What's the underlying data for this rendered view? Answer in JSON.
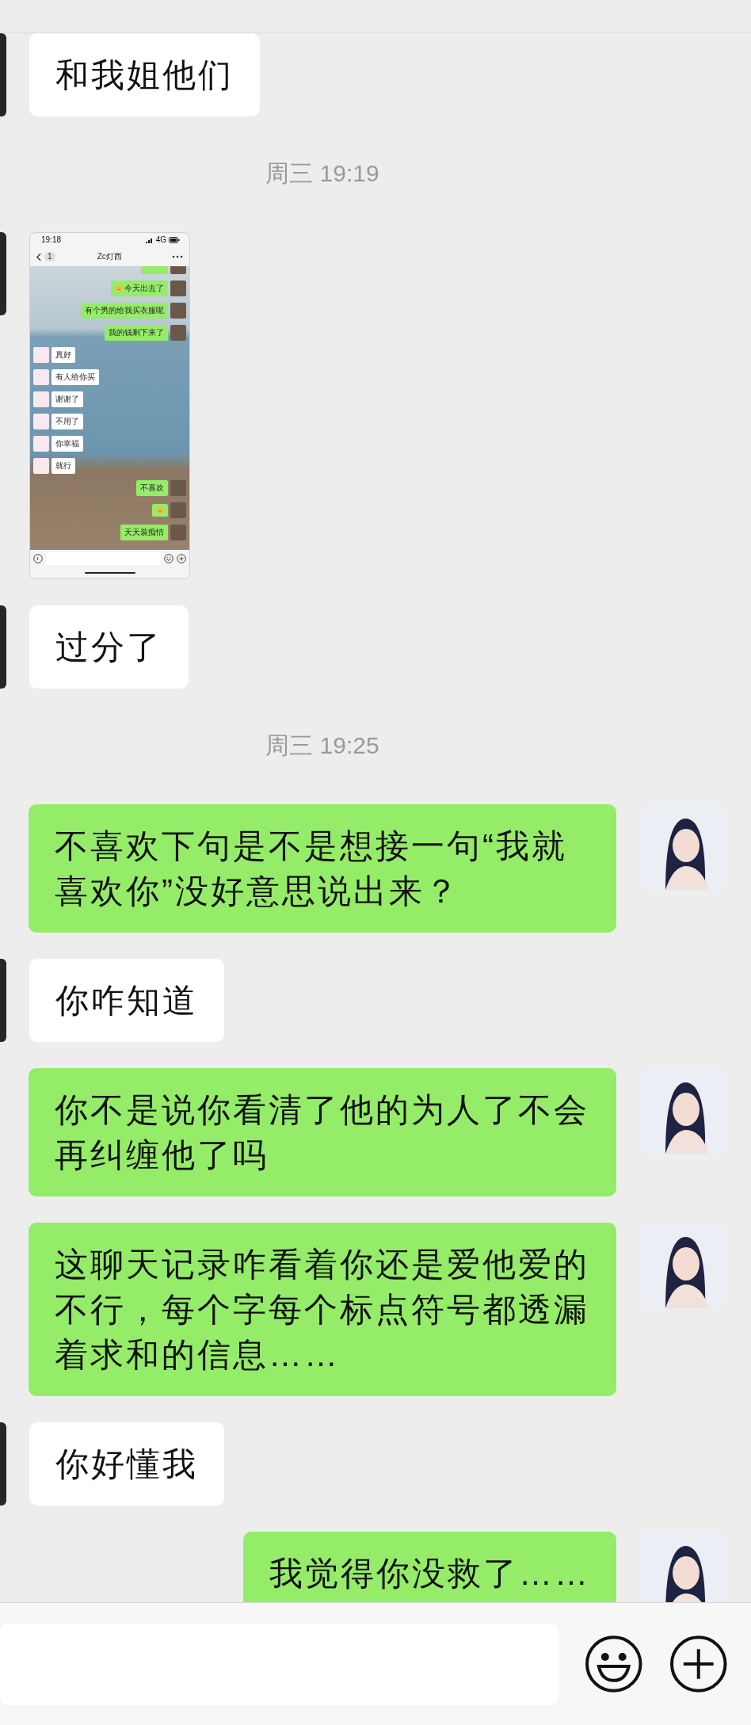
{
  "messages": [
    {
      "kind": "text",
      "outgoing": false,
      "text": "和我姐他们"
    },
    {
      "kind": "time",
      "text": "周三 19:19"
    },
    {
      "kind": "image",
      "outgoing": false,
      "screenshot": {
        "status_time": "19:18",
        "network": "4G",
        "title": "Zc灯西",
        "unread_badge": "1",
        "messages": [
          {
            "kind": "cut",
            "outgoing": true
          },
          {
            "kind": "emoji-text",
            "outgoing": true,
            "text": "今天出去了"
          },
          {
            "kind": "text",
            "outgoing": true,
            "text": "有个男的给我买衣服呢"
          },
          {
            "kind": "text",
            "outgoing": true,
            "text": "我的钱剩下来了"
          },
          {
            "kind": "text",
            "outgoing": false,
            "text": "真好"
          },
          {
            "kind": "text",
            "outgoing": false,
            "text": "有人给你买"
          },
          {
            "kind": "text",
            "outgoing": false,
            "text": "谢谢了"
          },
          {
            "kind": "text",
            "outgoing": false,
            "text": "不用了"
          },
          {
            "kind": "text",
            "outgoing": false,
            "text": "你幸福"
          },
          {
            "kind": "text",
            "outgoing": false,
            "text": "就行"
          },
          {
            "kind": "text",
            "outgoing": true,
            "text": "不喜欢"
          },
          {
            "kind": "emoji",
            "outgoing": true
          },
          {
            "kind": "text",
            "outgoing": true,
            "text": "天天装痴情"
          }
        ]
      }
    },
    {
      "kind": "text",
      "outgoing": false,
      "text": "过分了"
    },
    {
      "kind": "time",
      "text": "周三 19:25"
    },
    {
      "kind": "text",
      "outgoing": true,
      "text": "不喜欢下句是不是想接一句“我就喜欢你”没好意思说出来？"
    },
    {
      "kind": "text",
      "outgoing": false,
      "text": "你咋知道"
    },
    {
      "kind": "text",
      "outgoing": true,
      "text": "你不是说你看清了他的为人了不会再纠缠他了吗"
    },
    {
      "kind": "text",
      "outgoing": true,
      "text": "这聊天记录咋看着你还是爱他爱的不行，每个字每个标点符号都透漏着求和的信息……"
    },
    {
      "kind": "text",
      "outgoing": false,
      "text": "你好懂我"
    },
    {
      "kind": "text",
      "outgoing": true,
      "text": "我觉得你没救了……"
    }
  ]
}
